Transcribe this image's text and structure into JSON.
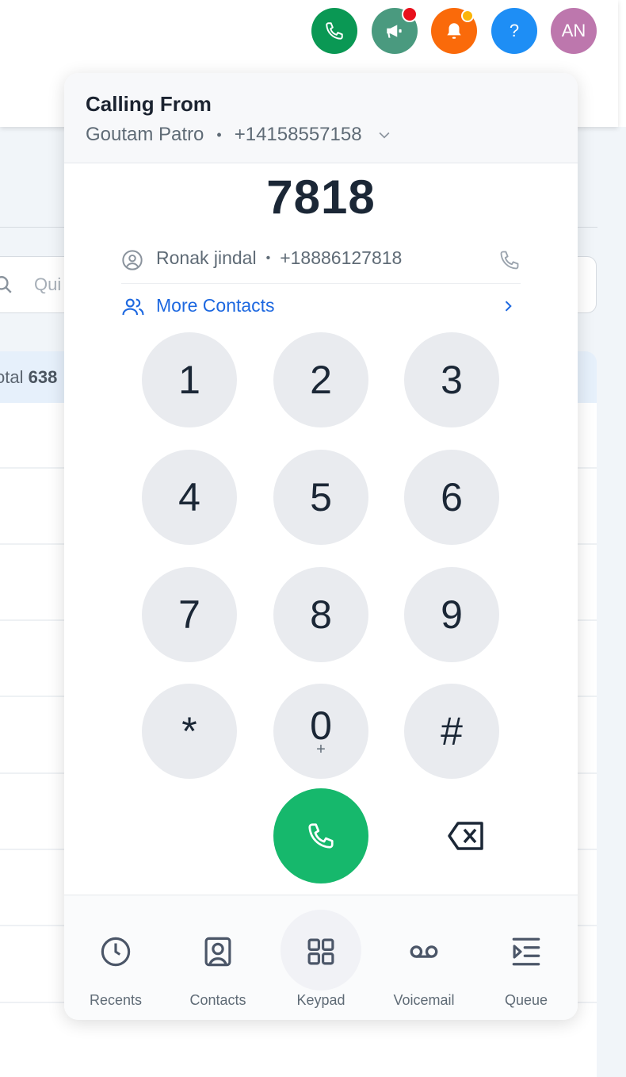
{
  "topbar": {
    "buttons": [
      {
        "name": "phone",
        "color": "#0a9854"
      },
      {
        "name": "announcements",
        "color": "#4a9a7f",
        "badge_color": "#e8101c"
      },
      {
        "name": "notifications",
        "color": "#fa6a0a",
        "badge_color": "#fbb50a"
      },
      {
        "name": "help",
        "color": "#1e8ef5",
        "label": "?"
      },
      {
        "name": "avatar",
        "color": "#bd77ad",
        "label": "AN"
      }
    ]
  },
  "background": {
    "search_placeholder": "Qui",
    "total_label": "otal ",
    "total_value": "638"
  },
  "dialer": {
    "calling_from": {
      "title": "Calling From",
      "name": "Goutam Patro",
      "separator": "•",
      "number": "+14158557158"
    },
    "dialed_number": "7818",
    "suggested_contact": {
      "name": "Ronak jindal",
      "separator": "•",
      "number": "+18886127818"
    },
    "more_contacts_label": "More Contacts",
    "keys": [
      {
        "digit": "1",
        "sub": ""
      },
      {
        "digit": "2",
        "sub": ""
      },
      {
        "digit": "3",
        "sub": ""
      },
      {
        "digit": "4",
        "sub": ""
      },
      {
        "digit": "5",
        "sub": ""
      },
      {
        "digit": "6",
        "sub": ""
      },
      {
        "digit": "7",
        "sub": ""
      },
      {
        "digit": "8",
        "sub": ""
      },
      {
        "digit": "9",
        "sub": ""
      },
      {
        "digit": "*",
        "sub": ""
      },
      {
        "digit": "0",
        "sub": "+"
      },
      {
        "digit": "#",
        "sub": ""
      }
    ],
    "call_color": "#16b86c",
    "nav": [
      {
        "label": "Recents",
        "icon": "clock-icon",
        "active": false
      },
      {
        "label": "Contacts",
        "icon": "contact-card-icon",
        "active": false
      },
      {
        "label": "Keypad",
        "icon": "keypad-grid-icon",
        "active": true
      },
      {
        "label": "Voicemail",
        "icon": "voicemail-icon",
        "active": false
      },
      {
        "label": "Queue",
        "icon": "queue-icon",
        "active": false
      }
    ]
  }
}
